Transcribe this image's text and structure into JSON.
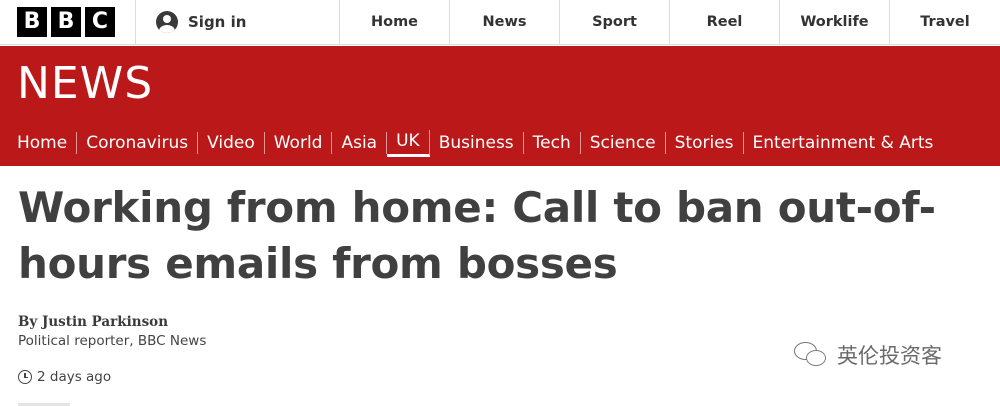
{
  "header": {
    "logo_letters": [
      "B",
      "B",
      "C"
    ],
    "signin_label": "Sign in",
    "nav": [
      "Home",
      "News",
      "Sport",
      "Reel",
      "Worklife",
      "Travel"
    ]
  },
  "banner": {
    "wordmark": "NEWS",
    "color": "#bb1919"
  },
  "section_nav": {
    "items": [
      "Home",
      "Coronavirus",
      "Video",
      "World",
      "Asia",
      "UK",
      "Business",
      "Tech",
      "Science",
      "Stories",
      "Entertainment & Arts"
    ],
    "active": "UK"
  },
  "article": {
    "headline": "Working from home: Call to ban out-of-hours emails from bosses",
    "byline": "By Justin Parkinson",
    "role": "Political reporter, BBC News",
    "timestamp": "2 days ago"
  },
  "watermark": {
    "text": "英伦投资客"
  }
}
